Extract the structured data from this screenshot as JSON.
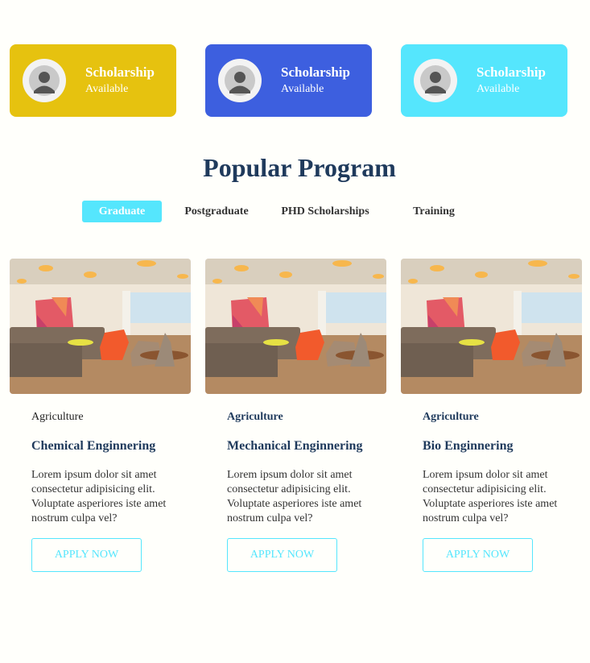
{
  "scholarships": [
    {
      "title": "Scholarship",
      "subtitle": "Available",
      "color": "#e6c20f",
      "icon": "user-avatar-icon"
    },
    {
      "title": "Scholarship",
      "subtitle": "Available",
      "color": "#3d5fdf",
      "icon": "user-avatar-icon"
    },
    {
      "title": "Scholarship",
      "subtitle": "Available",
      "color": "#55e6fd",
      "icon": "user-avatar-icon"
    }
  ],
  "section": {
    "title": "Popular Program"
  },
  "tabs": [
    {
      "label": "Graduate",
      "active": true
    },
    {
      "label": "Postgraduate",
      "active": false
    },
    {
      "label": "PHD Scholarships",
      "active": false
    },
    {
      "label": "Training",
      "active": false
    }
  ],
  "programs": [
    {
      "category": "Agriculture",
      "title": "Chemical Enginnering",
      "description": "Lorem ipsum dolor sit amet consectetur adipisicing elit. Voluptate asperiores iste amet nostrum culpa vel?",
      "button": "APPLY NOW"
    },
    {
      "category": "Agriculture",
      "title": "Mechanical Enginnering",
      "description": "Lorem ipsum dolor sit amet consectetur adipisicing elit. Voluptate asperiores iste amet nostrum culpa vel?",
      "button": "APPLY NOW"
    },
    {
      "category": "Agriculture",
      "title": "Bio Enginnering",
      "description": "Lorem ipsum dolor sit amet consectetur adipisicing elit. Voluptate asperiores iste amet nostrum culpa vel?",
      "button": "APPLY NOW"
    }
  ],
  "colors": {
    "accent": "#55e6fd",
    "heading": "#1f3a5c",
    "background": "#fffffb"
  }
}
